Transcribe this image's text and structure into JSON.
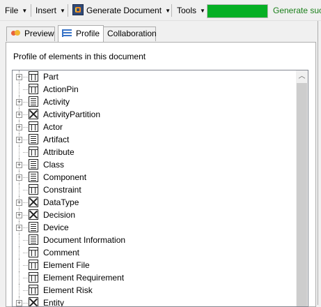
{
  "toolbar": {
    "file_label": "File",
    "insert_label": "Insert",
    "generate_label": "Generate Document",
    "generate_icon": "generate-document-icon",
    "tools_label": "Tools",
    "progress_fraction": 1.0,
    "status_text": "Generate suc",
    "colors": {
      "progress": "#06b025",
      "status_text": "#1a7f1a"
    }
  },
  "tabs": [
    {
      "label": "Preview",
      "icon": "preview-icon",
      "active": false
    },
    {
      "label": "Profile",
      "icon": "profile-icon",
      "active": true
    },
    {
      "label": "Collaboration",
      "icon": "",
      "active": false
    }
  ],
  "panel": {
    "title": "Profile of elements in this document"
  },
  "tree": {
    "items": [
      {
        "label": "Part",
        "icon": "table",
        "expander": "+"
      },
      {
        "label": "ActionPin",
        "icon": "table",
        "expander": ""
      },
      {
        "label": "Activity",
        "icon": "list",
        "expander": "+"
      },
      {
        "label": "ActivityPartition",
        "icon": "cross",
        "expander": "+"
      },
      {
        "label": "Actor",
        "icon": "table",
        "expander": "+"
      },
      {
        "label": "Artifact",
        "icon": "list",
        "expander": "+"
      },
      {
        "label": "Attribute",
        "icon": "table",
        "expander": ""
      },
      {
        "label": "Class",
        "icon": "list",
        "expander": "+"
      },
      {
        "label": "Component",
        "icon": "list",
        "expander": "+"
      },
      {
        "label": "Constraint",
        "icon": "table",
        "expander": ""
      },
      {
        "label": "DataType",
        "icon": "cross",
        "expander": "+"
      },
      {
        "label": "Decision",
        "icon": "cross",
        "expander": "+"
      },
      {
        "label": "Device",
        "icon": "list",
        "expander": "+"
      },
      {
        "label": "Document Information",
        "icon": "list",
        "expander": ""
      },
      {
        "label": "Comment",
        "icon": "table",
        "expander": ""
      },
      {
        "label": "Element File",
        "icon": "table",
        "expander": ""
      },
      {
        "label": "Element Requirement",
        "icon": "table",
        "expander": ""
      },
      {
        "label": "Element Risk",
        "icon": "table",
        "expander": ""
      },
      {
        "label": "Entity",
        "icon": "cross",
        "expander": "+"
      }
    ]
  }
}
